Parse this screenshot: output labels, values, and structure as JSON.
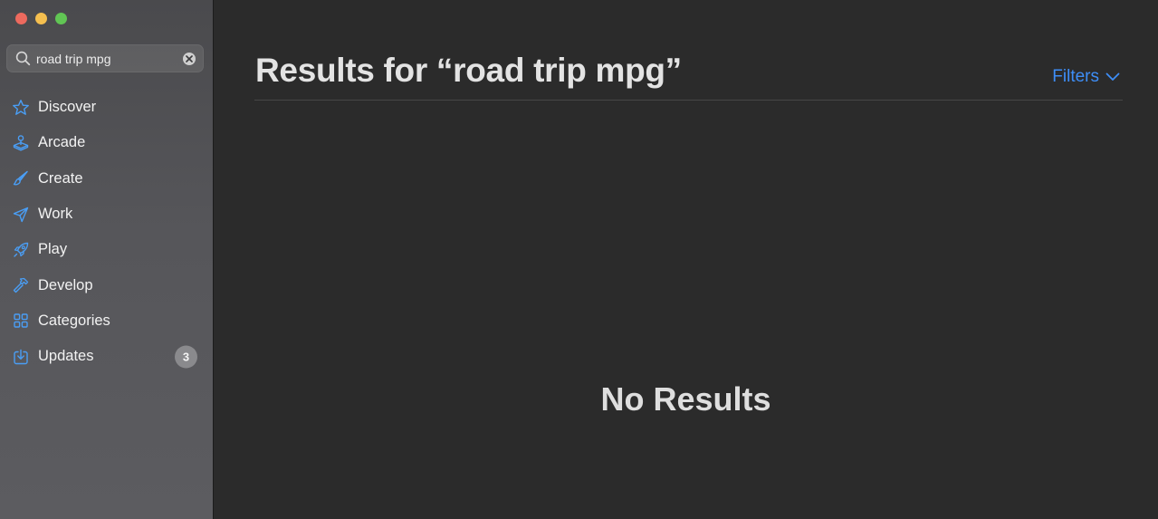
{
  "window": {
    "traffic_lights": [
      "close",
      "minimize",
      "zoom"
    ]
  },
  "search": {
    "value": "road trip mpg",
    "icon": "magnifying-glass-icon",
    "clear_icon": "clear-icon"
  },
  "sidebar": {
    "items": [
      {
        "label": "Discover",
        "icon": "star-icon"
      },
      {
        "label": "Arcade",
        "icon": "joystick-icon"
      },
      {
        "label": "Create",
        "icon": "paintbrush-icon"
      },
      {
        "label": "Work",
        "icon": "paperplane-icon"
      },
      {
        "label": "Play",
        "icon": "rocket-icon"
      },
      {
        "label": "Develop",
        "icon": "hammer-icon"
      },
      {
        "label": "Categories",
        "icon": "grid-icon"
      },
      {
        "label": "Updates",
        "icon": "download-icon",
        "badge": "3"
      }
    ]
  },
  "main": {
    "title": "Results for “road trip mpg”",
    "filters_label": "Filters",
    "empty_message": "No Results"
  },
  "colors": {
    "accent": "#3e8ef7",
    "sidebar_icon": "#4a9ef5",
    "main_bg": "#2b2b2b"
  }
}
